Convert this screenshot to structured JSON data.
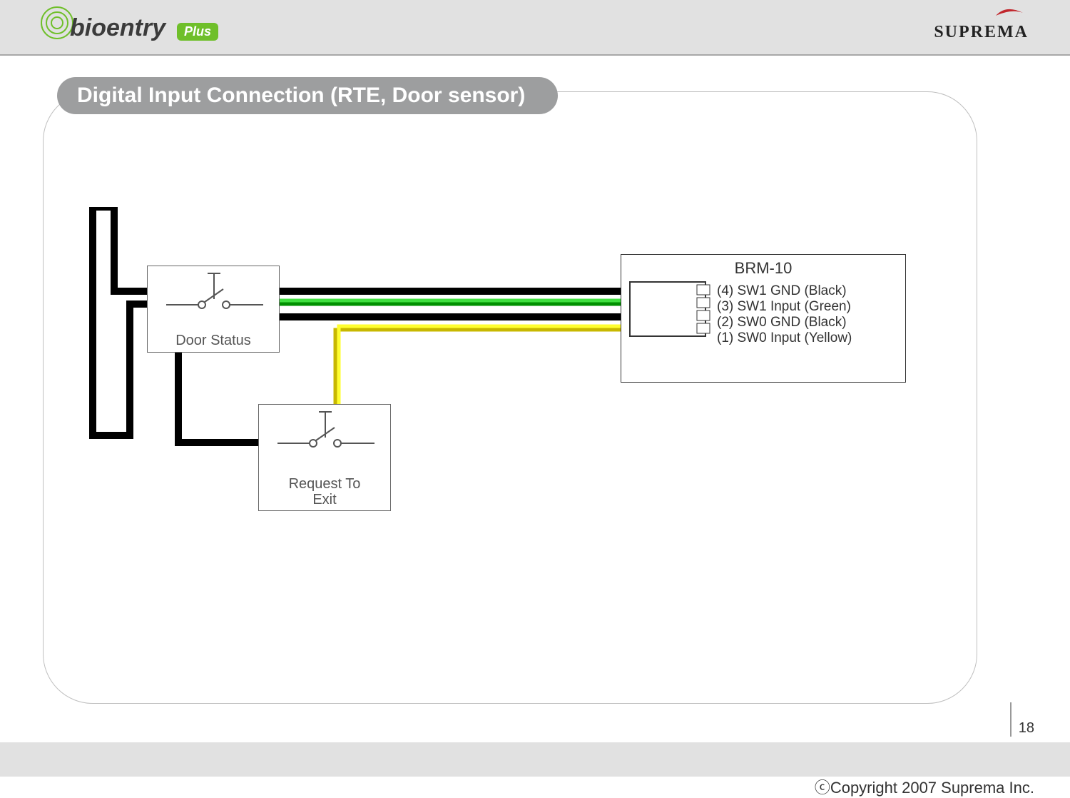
{
  "header": {
    "left_logo_main": "bioentry",
    "left_logo_badge": "Plus",
    "right_logo": "SUPREMA"
  },
  "panel": {
    "title": "Digital Input Connection (RTE, Door sensor)"
  },
  "diagram": {
    "switches": {
      "door": {
        "label": "Door Status"
      },
      "rte": {
        "label_line1": "Request To",
        "label_line2": "Exit"
      }
    },
    "module": {
      "name": "BRM-10",
      "pins": [
        {
          "num": 4,
          "label": "(4) SW1 GND (Black)",
          "wire_color": "#000000"
        },
        {
          "num": 3,
          "label": "(3) SW1 Input (Green)",
          "wire_color": "#00c000"
        },
        {
          "num": 2,
          "label": "(2) SW0 GND (Black)",
          "wire_color": "#000000"
        },
        {
          "num": 1,
          "label": "(1) SW0 Input (Yellow)",
          "wire_color": "#f5e600"
        }
      ]
    }
  },
  "footer": {
    "page": "18",
    "copyright": "ⓒCopyright 2007 Suprema Inc."
  }
}
